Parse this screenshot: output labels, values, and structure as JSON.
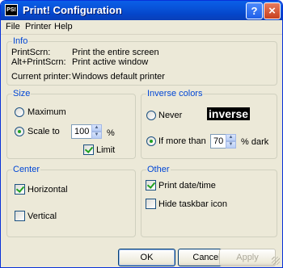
{
  "window": {
    "title": "Print! Configuration",
    "icon_text": "PS!",
    "help_glyph": "?",
    "close_glyph": "×"
  },
  "menu": [
    "File",
    "Printer",
    "Help"
  ],
  "info": {
    "title": "Info",
    "rows": [
      {
        "key": "PrintScrn:",
        "value": "Print the entire screen"
      },
      {
        "key": "Alt+PrintScrn:",
        "value": "Print active window"
      },
      {
        "key": "Current printer:",
        "value": "Windows default printer"
      }
    ]
  },
  "size": {
    "title": "Size",
    "maximum_label": "Maximum",
    "maximum_checked": false,
    "scale_label": "Scale to",
    "scale_checked": true,
    "scale_value": "100",
    "scale_unit": "%",
    "limit_label": "Limit",
    "limit_checked": true
  },
  "inverse": {
    "title": "Inverse colors",
    "never_label": "Never",
    "never_checked": false,
    "sample_text": "inverse",
    "if_more_label": "If more than",
    "if_more_checked": true,
    "value": "70",
    "unit": "% dark"
  },
  "center": {
    "title": "Center",
    "horizontal_label": "Horizontal",
    "horizontal_checked": true,
    "vertical_label": "Vertical",
    "vertical_checked": false
  },
  "other": {
    "title": "Other",
    "print_date_label": "Print date/time",
    "print_date_checked": true,
    "hide_taskbar_label": "Hide taskbar icon",
    "hide_taskbar_checked": false
  },
  "buttons": {
    "ok": "OK",
    "cancel": "Cancel",
    "apply": "Apply"
  },
  "spin_up_glyph": "▲",
  "spin_down_glyph": "▼"
}
